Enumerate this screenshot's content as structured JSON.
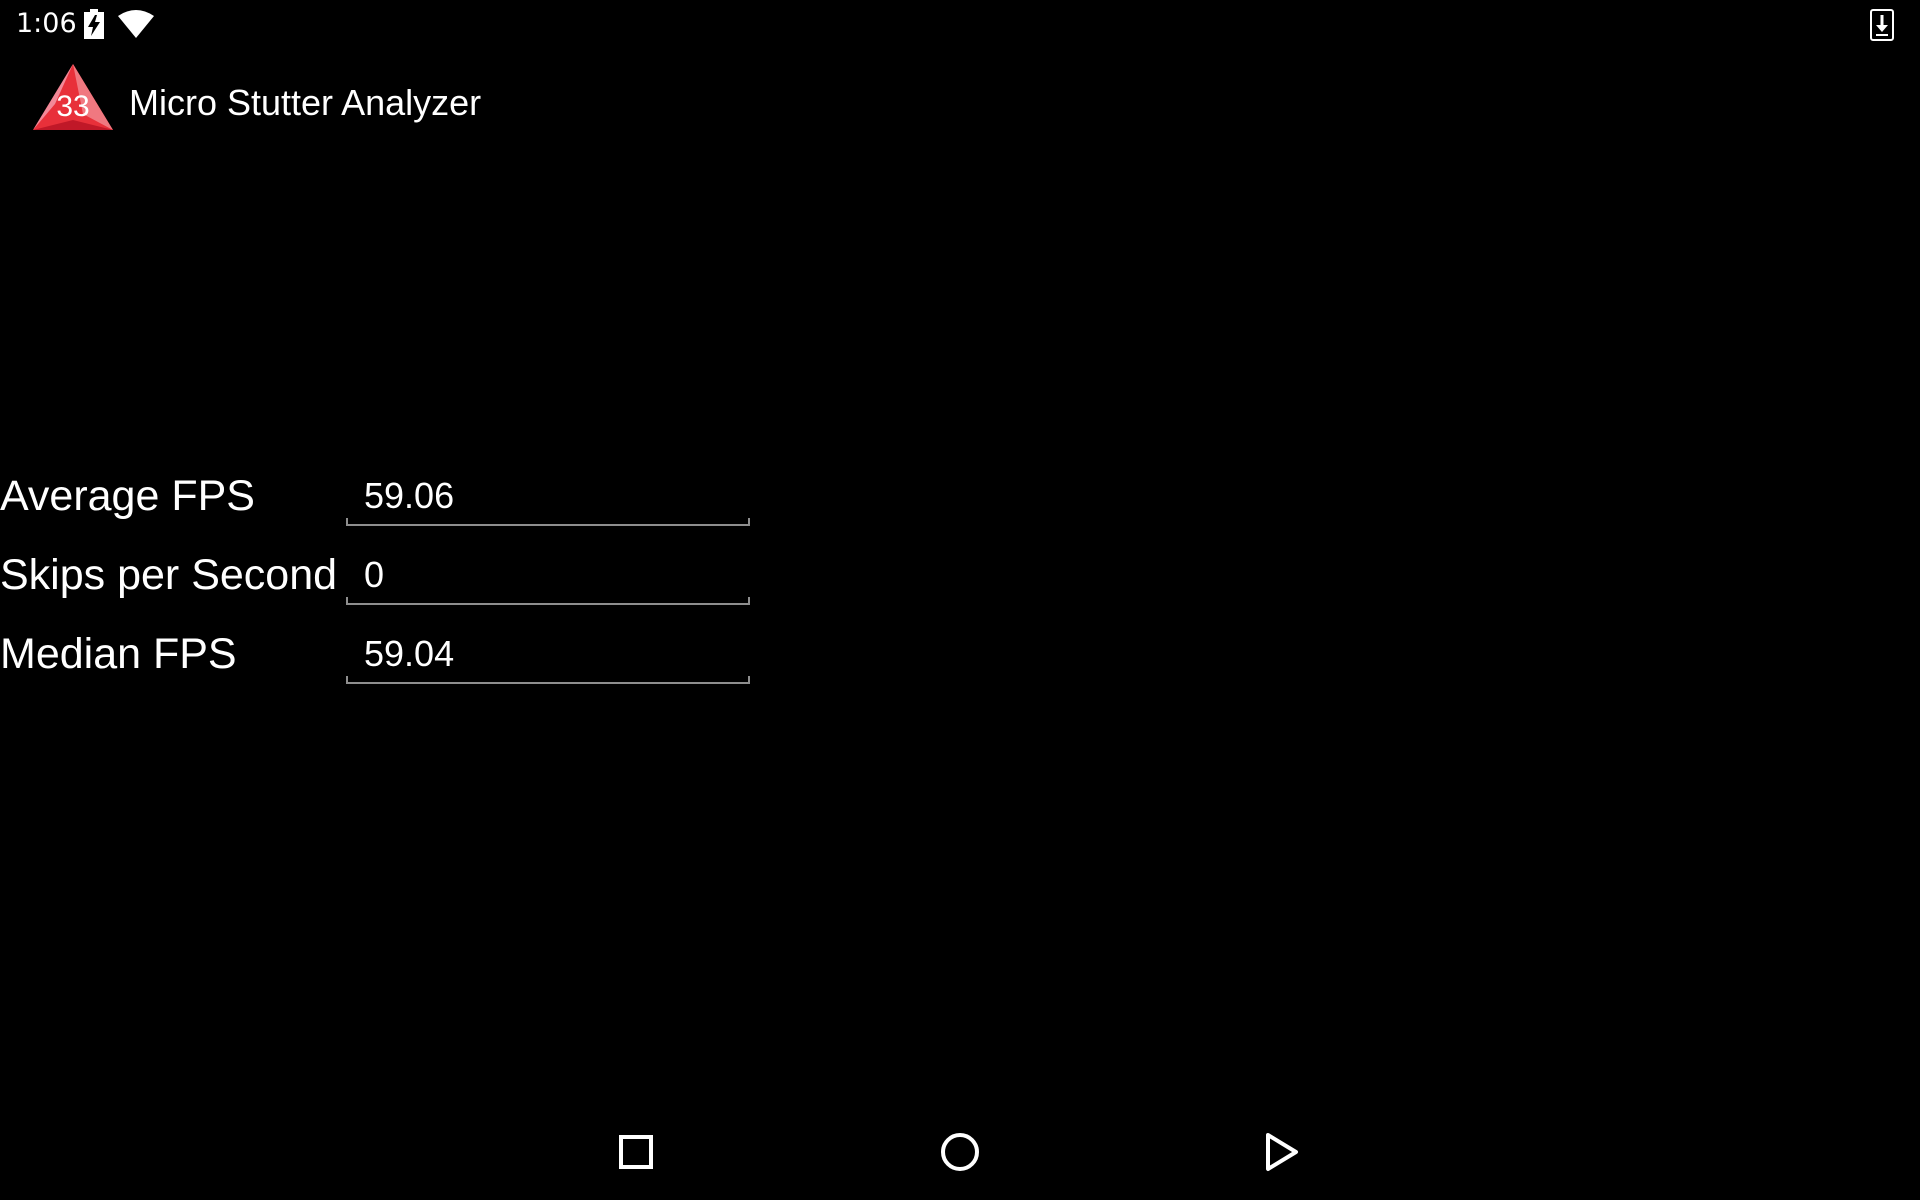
{
  "status_bar": {
    "time": "1:06",
    "icons": [
      "battery-charging-icon",
      "wifi-icon",
      "download-icon"
    ]
  },
  "app": {
    "title": "Micro Stutter Analyzer",
    "logo_badge": "33",
    "logo_colors": [
      "#e8303a",
      "#f07880",
      "#f4a0b0"
    ]
  },
  "stats": [
    {
      "label": "Average FPS",
      "value": "59.06"
    },
    {
      "label": "Skips per Second",
      "value": "0"
    },
    {
      "label": "Median FPS",
      "value": "59.04"
    }
  ],
  "nav_bar": {
    "buttons": [
      "recents-icon",
      "home-icon",
      "back-icon"
    ]
  },
  "colors": {
    "background": "#000000",
    "text": "#ffffff",
    "field_underline": "#8e8e8e"
  }
}
